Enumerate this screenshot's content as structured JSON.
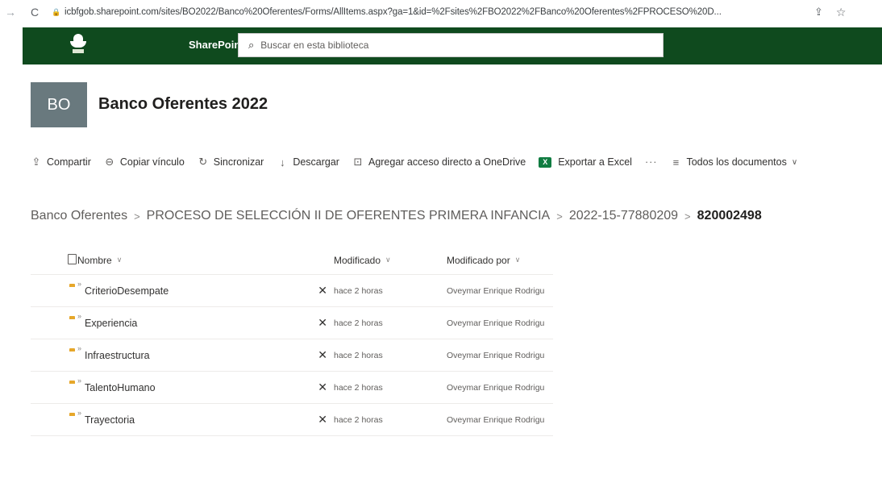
{
  "browser": {
    "url": "icbfgob.sharepoint.com/sites/BO2022/Banco%20Oferentes/Forms/AllItems.aspx?ga=1&id=%2Fsites%2FBO2022%2FBanco%20Oferentes%2FPROCESO%20D..."
  },
  "suitebar": {
    "brand": "SharePoint",
    "search_placeholder": "Buscar en esta biblioteca",
    "background": "#0f4a1e"
  },
  "site": {
    "initials": "BO",
    "title": "Banco Oferentes 2022"
  },
  "commands": {
    "share": "Compartir",
    "copy_link": "Copiar vínculo",
    "sync": "Sincronizar",
    "download": "Descargar",
    "add_shortcut": "Agregar acceso directo a OneDrive",
    "export_excel": "Exportar a Excel",
    "more": "···",
    "view": "Todos los documentos"
  },
  "breadcrumb": {
    "items": [
      "Banco Oferentes",
      "PROCESO DE SELECCIÓN II DE OFERENTES PRIMERA INFANCIA",
      "2022-15-77880209"
    ],
    "current": "820002498"
  },
  "list": {
    "headers": {
      "name": "Nombre",
      "modified": "Modificado",
      "modified_by": "Modificado por"
    },
    "rows": [
      {
        "name": "CriterioDesempate",
        "modified": "hace 2 horas",
        "modified_by": "Oveymar Enrique Rodrigu"
      },
      {
        "name": "Experiencia",
        "modified": "hace 2 horas",
        "modified_by": "Oveymar Enrique Rodrigu"
      },
      {
        "name": "Infraestructura",
        "modified": "hace 2 horas",
        "modified_by": "Oveymar Enrique Rodrigu"
      },
      {
        "name": "TalentoHumano",
        "modified": "hace 2 horas",
        "modified_by": "Oveymar Enrique Rodrigu"
      },
      {
        "name": "Trayectoria",
        "modified": "hace 2 horas",
        "modified_by": "Oveymar Enrique Rodrigu"
      }
    ]
  }
}
